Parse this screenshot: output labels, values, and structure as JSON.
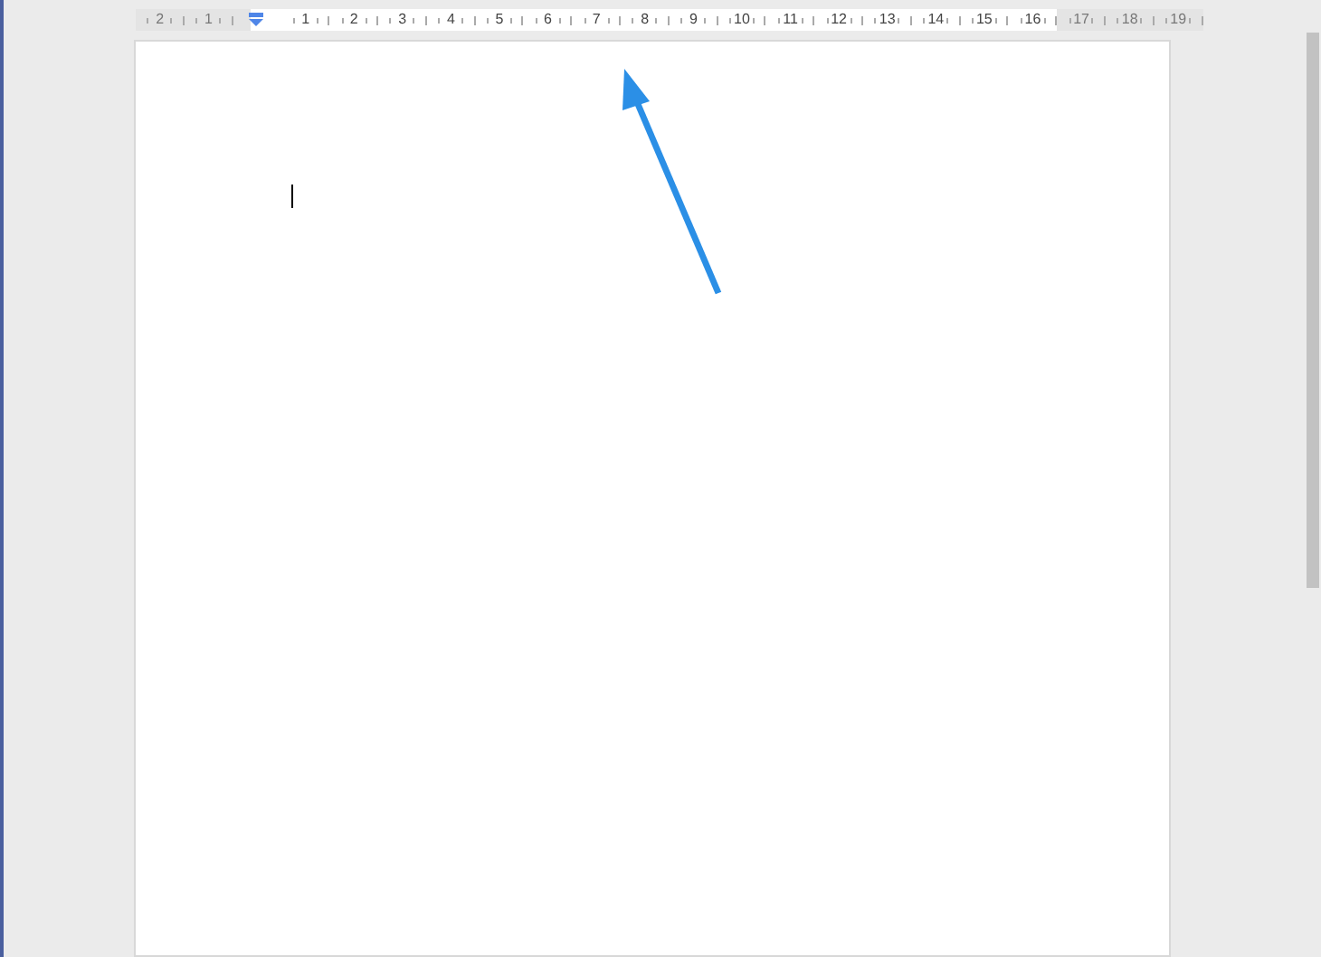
{
  "ruler": {
    "labels": [
      {
        "text": "2",
        "margin": true
      },
      {
        "text": "1",
        "margin": true
      },
      {
        "text": "1",
        "margin": false
      },
      {
        "text": "2",
        "margin": false
      },
      {
        "text": "3",
        "margin": false
      },
      {
        "text": "4",
        "margin": false
      },
      {
        "text": "5",
        "margin": false
      },
      {
        "text": "6",
        "margin": false
      },
      {
        "text": "7",
        "margin": false
      },
      {
        "text": "8",
        "margin": false
      },
      {
        "text": "9",
        "margin": false
      },
      {
        "text": "10",
        "margin": false
      },
      {
        "text": "11",
        "margin": false
      },
      {
        "text": "12",
        "margin": false
      },
      {
        "text": "13",
        "margin": false
      },
      {
        "text": "14",
        "margin": false
      },
      {
        "text": "15",
        "margin": false
      },
      {
        "text": "16",
        "margin": false
      },
      {
        "text": "17",
        "margin": true
      },
      {
        "text": "18",
        "margin": true
      },
      {
        "text": "19",
        "margin": true
      }
    ]
  }
}
